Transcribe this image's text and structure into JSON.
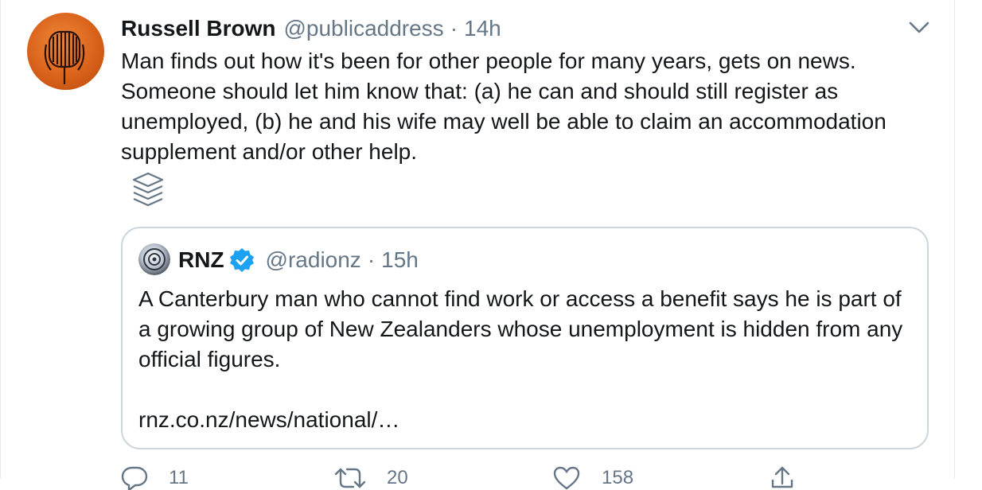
{
  "tweet": {
    "author_name": "Russell Brown",
    "author_handle": "@publicaddress",
    "separator": "·",
    "time": "14h",
    "text": "Man finds out how it's been for other people for many years, gets on news. Someone should let him know that: (a) he can and should still register as unemployed, (b) he and his wife may well be able to claim an accommodation supplement and/or other help.",
    "icons": {
      "avatar": "microphone-avatar",
      "menu": "chevron-down-icon",
      "thread": "layers-icon"
    }
  },
  "quoted": {
    "author_name": "RNZ",
    "verified": true,
    "author_handle": "@radionz",
    "separator": "·",
    "time": "15h",
    "text": "A Canterbury man who cannot find work or access a benefit says he is part of a growing group of New Zealanders whose unemployment is hidden from any official figures.",
    "link": "rnz.co.nz/news/national/…",
    "icons": {
      "avatar": "rnz-logo",
      "verified": "verified-badge-icon"
    }
  },
  "actions": {
    "reply_count": "11",
    "retweet_count": "20",
    "like_count": "158",
    "icons": [
      "reply-icon",
      "retweet-icon",
      "like-icon",
      "share-icon"
    ]
  },
  "colors": {
    "text": "#14171a",
    "secondary": "#657786",
    "border": "#ccd6dd",
    "verified": "#1da1f2",
    "avatar": "#d9621a"
  }
}
